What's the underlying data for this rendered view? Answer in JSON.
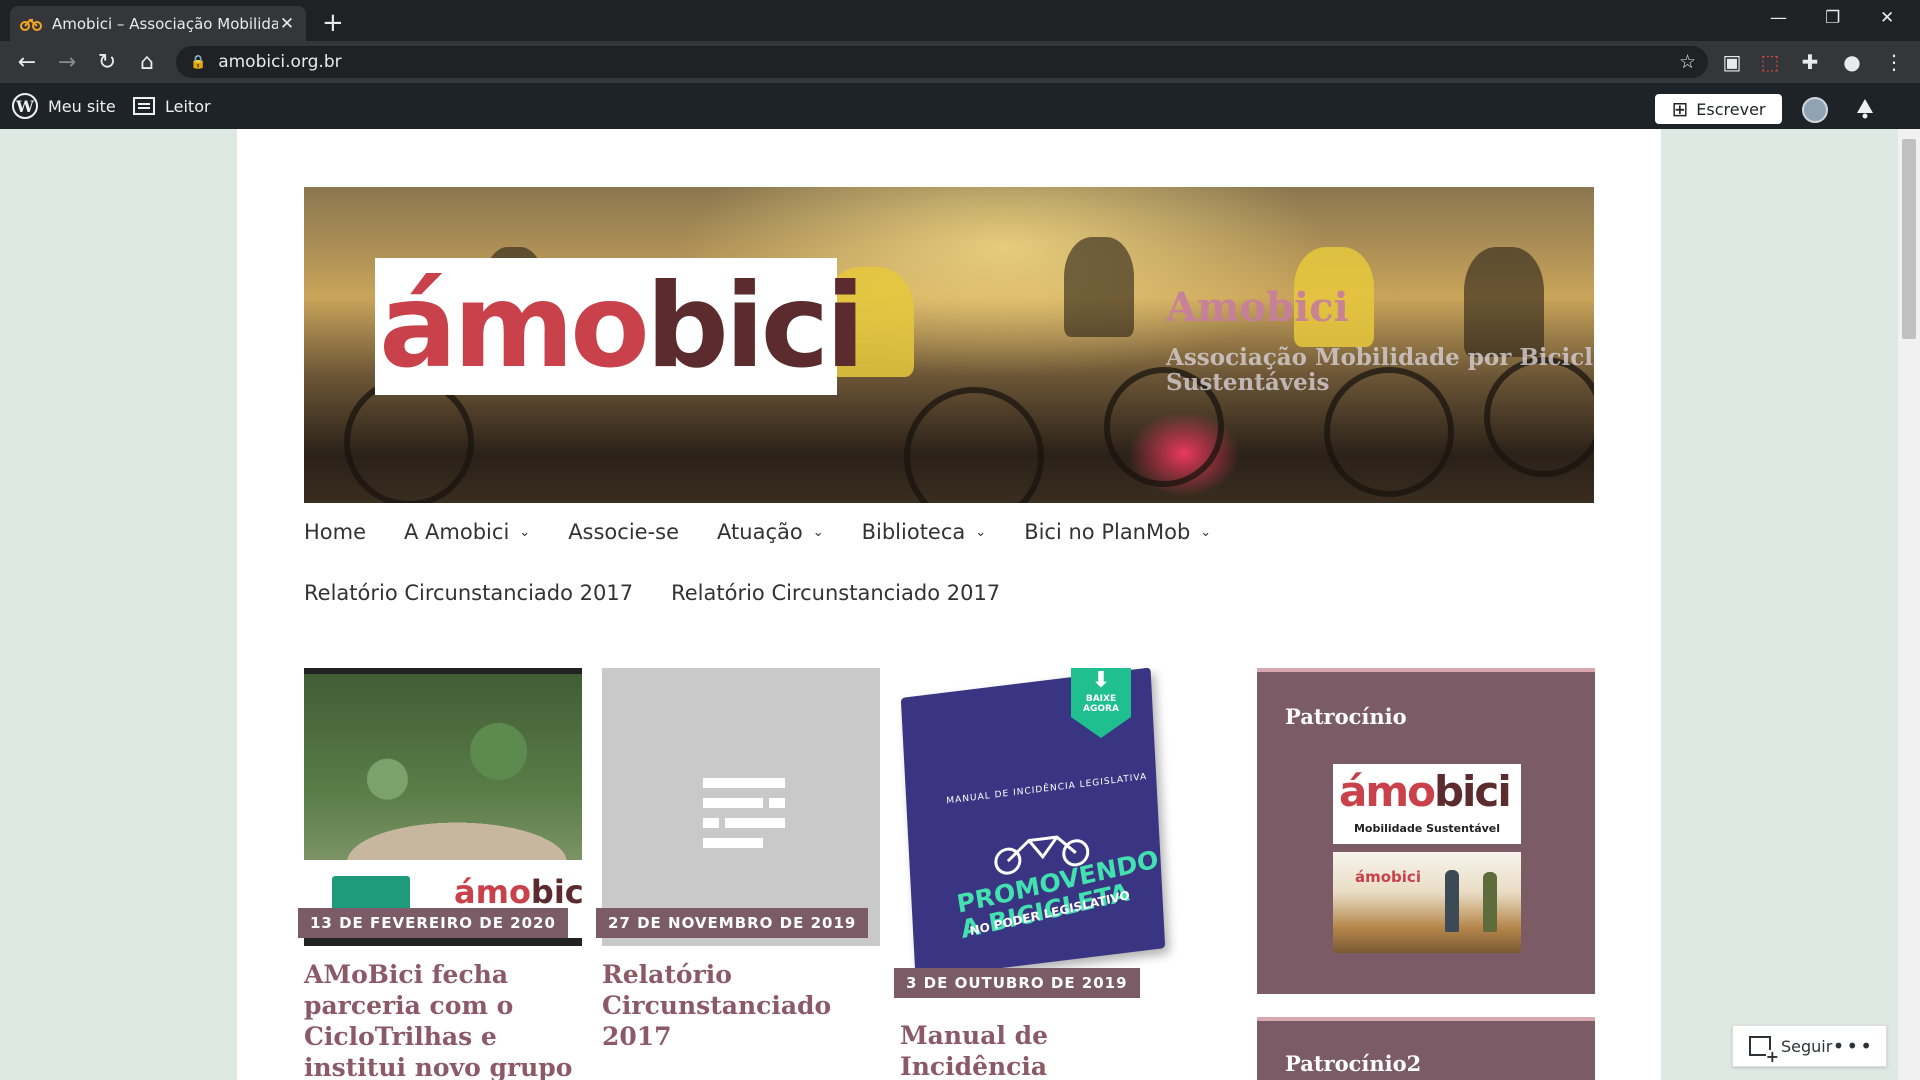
{
  "browser": {
    "tab_title": "Amobici – Associação Mobilidade",
    "url": "amobici.org.br"
  },
  "adminbar": {
    "my_site": "Meu site",
    "reader": "Leitor",
    "write": "Escrever"
  },
  "site": {
    "logo_text_red": "ámo",
    "logo_text_dark": "bici",
    "title": "Amobici",
    "description": "Associação Mobilidade por Bicicleta e Modos Sustentáveis"
  },
  "menu": {
    "row1": [
      {
        "label": "Home",
        "dropdown": false
      },
      {
        "label": "A Amobici",
        "dropdown": true
      },
      {
        "label": "Associe-se",
        "dropdown": false
      },
      {
        "label": "Atuação",
        "dropdown": true
      },
      {
        "label": "Biblioteca",
        "dropdown": true
      },
      {
        "label": "Bici no PlanMob",
        "dropdown": true
      }
    ],
    "row2": [
      {
        "label": "Relatório Circunstanciado 2017"
      },
      {
        "label": "Relatório Circunstanciado 2017"
      }
    ]
  },
  "posts": [
    {
      "date": "13 DE FEVEREIRO DE 2020",
      "title": "AMoBici fecha parceria com o CicloTrilhas e institui novo grupo de"
    },
    {
      "date": "27 DE NOVEMBRO DE 2019",
      "title": "Relatório Circunstanciado 2017"
    },
    {
      "date": "3 DE OUTUBRO DE 2019",
      "title": "Manual de Incidência Legislativa da UCB"
    }
  ],
  "book": {
    "header": "MANUAL DE INCIDÊNCIA LEGISLATIVA",
    "line1": "PROMOVENDO",
    "line2": "A BICICLETA",
    "line3": "NO PODER LEGISLATIVO",
    "ribbon": "BAIXE AGORA"
  },
  "thumb1": {
    "logo_red": "ámo",
    "logo_dark": "bici"
  },
  "sidebar": {
    "widget1_title": "Patrocínio",
    "widget2_title": "Patrocínio2",
    "sponsor_logo_red": "ámo",
    "sponsor_logo_dark": "bici",
    "sponsor_subtitle": "Mobilidade Sustentável",
    "sponsor2_logo": "ámobici"
  },
  "follow": {
    "label": "Seguir"
  },
  "colors": {
    "accent": "#7b5c66",
    "title": "#8b5a66",
    "logo_red": "#c8414b",
    "logo_dark": "#5b2b2e"
  }
}
